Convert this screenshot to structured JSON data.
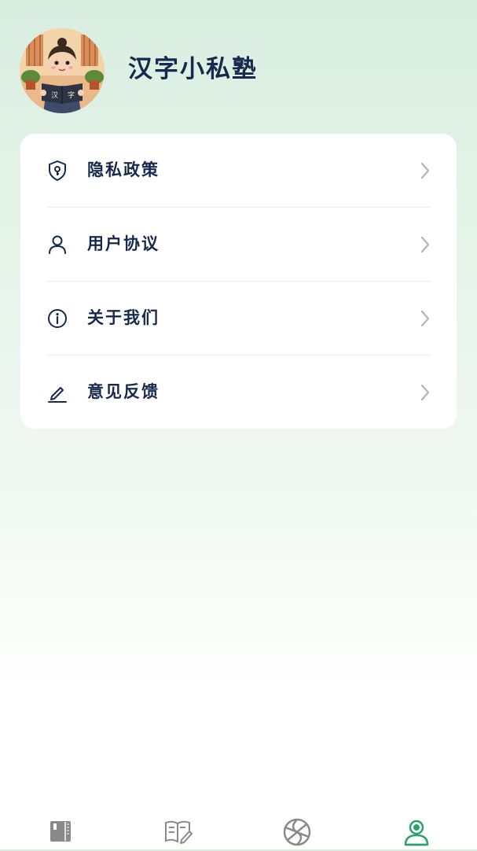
{
  "app": {
    "name": "汉字小私塾",
    "avatar_icon": "scholar-boy-reading-avatar",
    "book_left_char": "汉",
    "book_right_char": "字"
  },
  "menu": {
    "items": [
      {
        "label": "隐私政策",
        "icon": "shield-key-icon"
      },
      {
        "label": "用户协议",
        "icon": "user-icon"
      },
      {
        "label": "关于我们",
        "icon": "info-icon"
      },
      {
        "label": "意见反馈",
        "icon": "pencil-icon"
      }
    ]
  },
  "tabbar": {
    "tabs": [
      {
        "icon": "book-icon",
        "active": false
      },
      {
        "icon": "study-edit-icon",
        "active": false
      },
      {
        "icon": "swirl-icon",
        "active": false
      },
      {
        "icon": "profile-icon",
        "active": true
      }
    ],
    "active_color": "#2aa36b",
    "inactive_color": "#8a8a8a"
  },
  "colors": {
    "title": "#17294d",
    "chevron": "#b5b5b5",
    "card": "#ffffff"
  }
}
